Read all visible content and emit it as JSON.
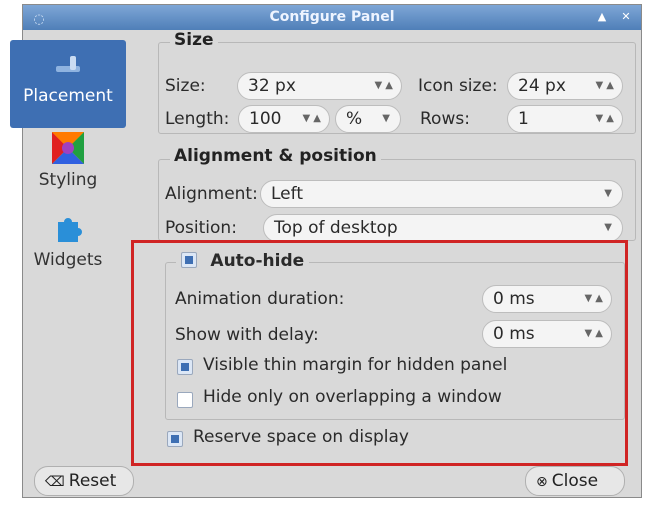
{
  "window": {
    "title": "Configure Panel"
  },
  "sidebar": {
    "items": [
      {
        "label": "Placement",
        "icon": "placement-icon",
        "active": true
      },
      {
        "label": "Styling",
        "icon": "styling-icon",
        "active": false
      },
      {
        "label": "Widgets",
        "icon": "widgets-icon",
        "active": false
      }
    ]
  },
  "size_group": {
    "title": "Size",
    "size_label": "Size:",
    "size_value": "32 px",
    "icon_size_label": "Icon size:",
    "icon_size_value": "24 px",
    "length_label": "Length:",
    "length_value": "100",
    "length_unit": "%",
    "rows_label": "Rows:",
    "rows_value": "1"
  },
  "alignment_group": {
    "title": "Alignment & position",
    "alignment_label": "Alignment:",
    "alignment_value": "Left",
    "position_label": "Position:",
    "position_value": "Top of desktop"
  },
  "autohide_group": {
    "title": "Auto-hide",
    "checked": true,
    "animation_label": "Animation duration:",
    "animation_value": "0 ms",
    "delay_label": "Show with delay:",
    "delay_value": "0 ms",
    "thin_margin_label": "Visible thin margin for hidden panel",
    "thin_margin_checked": true,
    "overlap_label": "Hide only on overlapping a window",
    "overlap_checked": false
  },
  "reserve_space": {
    "label": "Reserve space on display",
    "checked": true
  },
  "buttons": {
    "reset": "Reset",
    "close": "Close"
  },
  "colors": {
    "accent": "#3e6fb3",
    "highlight": "#d02424",
    "titlebar": "#4f7fb8"
  }
}
